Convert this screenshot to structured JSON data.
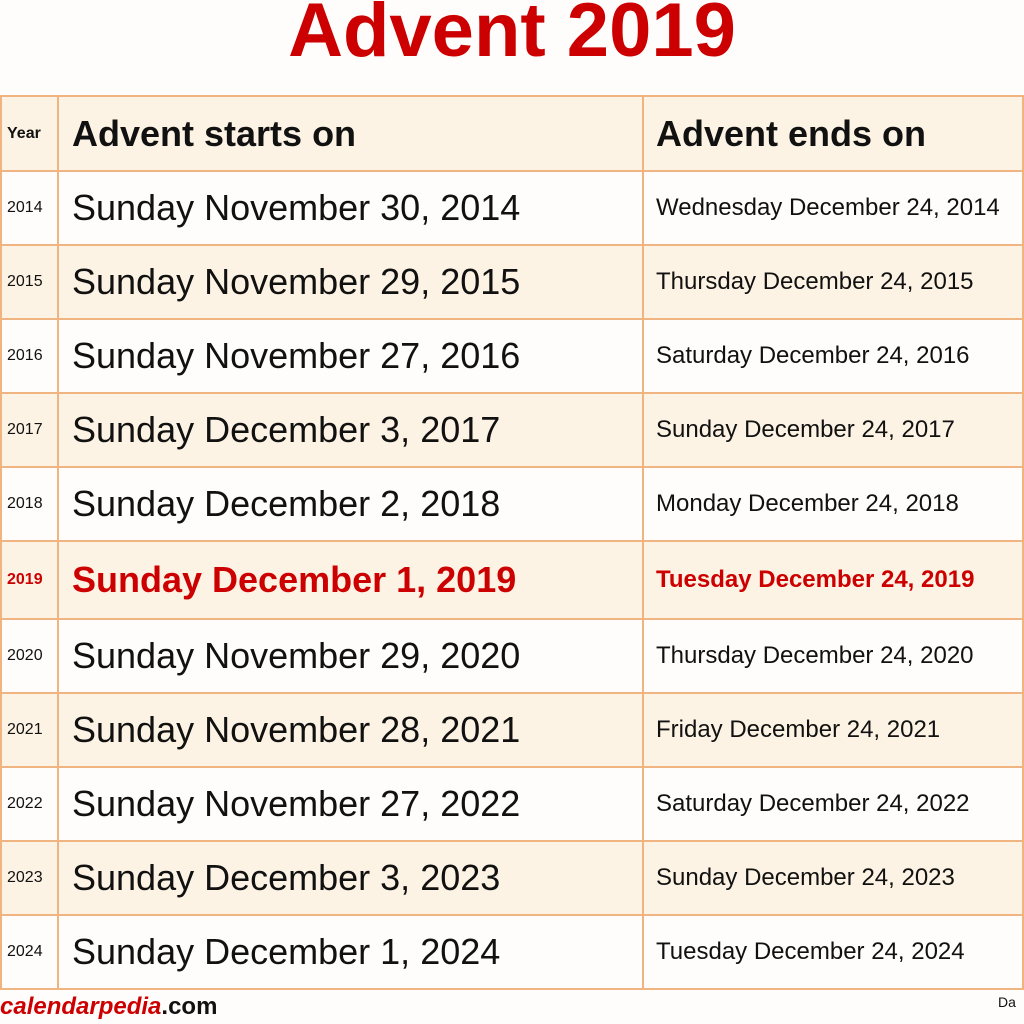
{
  "title": "Advent 2019",
  "table": {
    "headers": [
      "Year",
      "Advent starts on",
      "Advent ends on"
    ],
    "rows": [
      {
        "year": "2014",
        "start": "Sunday November 30, 2014",
        "end": "Wednesday December 24, 2014"
      },
      {
        "year": "2015",
        "start": "Sunday November 29, 2015",
        "end": "Thursday December 24, 2015"
      },
      {
        "year": "2016",
        "start": "Sunday November 27, 2016",
        "end": "Saturday December 24, 2016"
      },
      {
        "year": "2017",
        "start": "Sunday December 3, 2017",
        "end": "Sunday December 24, 2017"
      },
      {
        "year": "2018",
        "start": "Sunday December 2, 2018",
        "end": "Monday December 24, 2018"
      },
      {
        "year": "2019",
        "start": "Sunday December 1, 2019",
        "end": "Tuesday December 24, 2019"
      },
      {
        "year": "2020",
        "start": "Sunday November 29, 2020",
        "end": "Thursday December 24, 2020"
      },
      {
        "year": "2021",
        "start": "Sunday November 28, 2021",
        "end": "Friday December 24, 2021"
      },
      {
        "year": "2022",
        "start": "Sunday November 27, 2022",
        "end": "Saturday December 24, 2022"
      },
      {
        "year": "2023",
        "start": "Sunday December 3, 2023",
        "end": "Sunday December 24, 2023"
      },
      {
        "year": "2024",
        "start": "Sunday December 1, 2024",
        "end": "Tuesday December 24, 2024"
      }
    ],
    "highlight_year": "2019"
  },
  "footer": {
    "brand": "calendarpedia",
    "domain": ".com",
    "note": "Da"
  },
  "colors": {
    "accent": "#cc0000",
    "border": "#efb47f",
    "alt_row": "#fdf3e4"
  }
}
